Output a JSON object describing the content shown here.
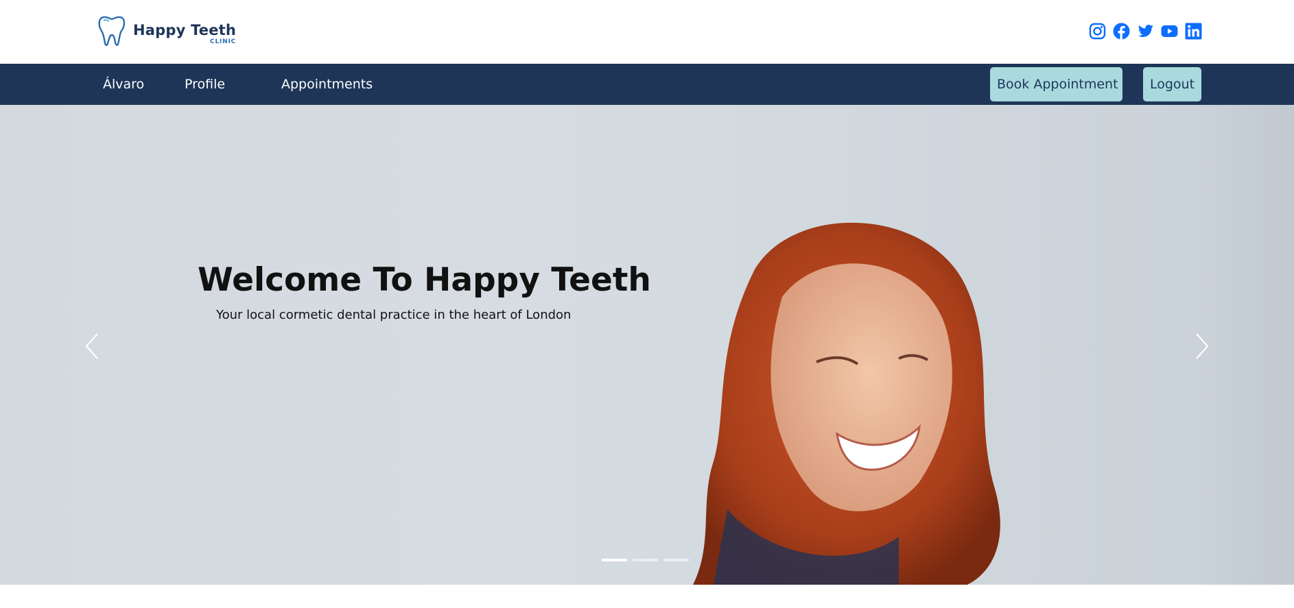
{
  "header": {
    "logo": {
      "name": "Happy Teeth",
      "sub": "CLINIC",
      "icon": "tooth-icon"
    },
    "social": [
      {
        "name": "instagram-icon",
        "color": "#0d6efd"
      },
      {
        "name": "facebook-icon",
        "color": "#0d6efd"
      },
      {
        "name": "twitter-icon",
        "color": "#0d6efd"
      },
      {
        "name": "youtube-icon",
        "color": "#0d6efd"
      },
      {
        "name": "linkedin-icon",
        "color": "#0d6efd"
      }
    ]
  },
  "nav": {
    "user": "Álvaro",
    "profile": "Profile",
    "appointments": "Appointments",
    "book": "Book Appointment",
    "logout": "Logout",
    "bg_color": "#1e3558",
    "button_color": "#a8dade"
  },
  "hero": {
    "title": "Welcome To Happy Teeth",
    "subtitle": "Your local cormetic dental practice in the heart of London",
    "prev_icon": "chevron-left-icon",
    "next_icon": "chevron-right-icon",
    "slides_total": 3,
    "active_slide": 1
  }
}
